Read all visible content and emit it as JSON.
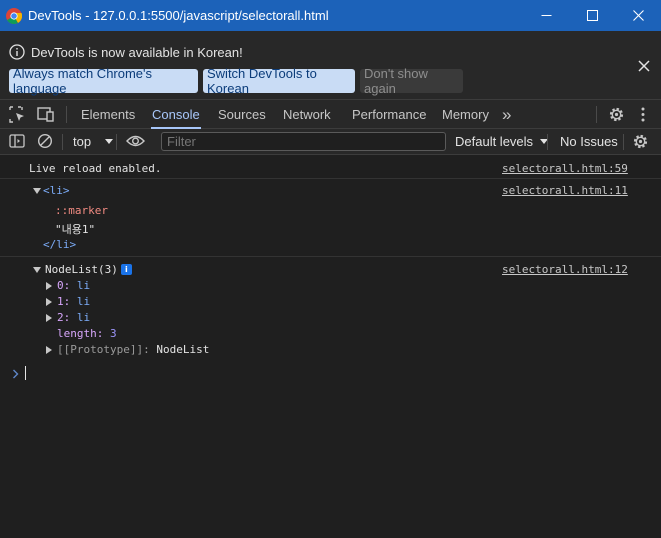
{
  "window": {
    "title": "DevTools - 127.0.0.1:5500/javascript/selectorall.html"
  },
  "infobar": {
    "message": "DevTools is now available in Korean!",
    "btn_match": "Always match Chrome's language",
    "btn_switch": "Switch DevTools to Korean",
    "btn_dismiss": "Don't show again"
  },
  "tabs": {
    "elements": "Elements",
    "console": "Console",
    "sources": "Sources",
    "network": "Network",
    "performance": "Performance",
    "memory": "Memory",
    "more": "»"
  },
  "console_toolbar": {
    "context": "top",
    "filter_placeholder": "Filter",
    "levels": "Default levels",
    "issues": "No Issues"
  },
  "messages": {
    "m1": {
      "text": "Live reload enabled.",
      "source": "selectorall.html:59"
    },
    "m2": {
      "source": "selectorall.html:11",
      "open_tag": "<li>",
      "marker": "::marker",
      "content": "\"내용1\"",
      "close_tag": "</li>"
    },
    "m3": {
      "source": "selectorall.html:12",
      "summary": "NodeList(3)",
      "info_badge": "i",
      "items": [
        {
          "key": "0",
          "value": "li"
        },
        {
          "key": "1",
          "value": "li"
        },
        {
          "key": "2",
          "value": "li"
        }
      ],
      "length_key": "length",
      "length_value": "3",
      "proto_key": "[[Prototype]]",
      "proto_value": "NodeList"
    }
  },
  "colors": {
    "titlebar": "#1c62b9",
    "accent": "#a8c7fa",
    "background": "#1f1f1f"
  },
  "icons": [
    "chrome-logo-icon",
    "minimize-icon",
    "maximize-icon",
    "close-icon",
    "info-icon",
    "inspect-icon",
    "device-toolbar-icon",
    "settings-icon",
    "kebab-menu-icon",
    "sidebar-icon",
    "clear-console-icon",
    "eye-icon",
    "chevron-down-icon"
  ]
}
